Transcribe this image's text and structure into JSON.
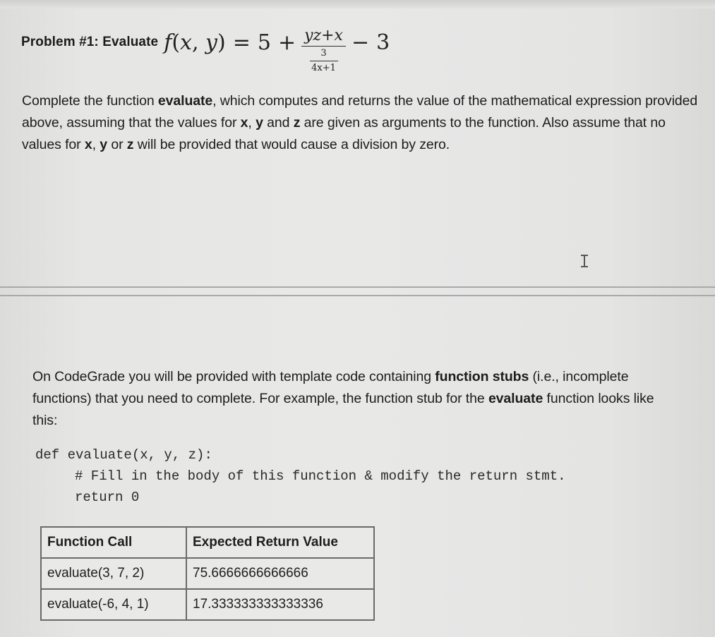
{
  "problem": {
    "heading_label": "Problem #1: Evaluate",
    "formula": {
      "lhs_func": "f",
      "lhs_args_open": "(",
      "lhs_x": "x",
      "lhs_sep": ", ",
      "lhs_y": "y",
      "lhs_args_close": ")",
      "equals": "=",
      "constant": "5",
      "plus": "+",
      "numerator": "yz+x",
      "inner_numerator": "3",
      "inner_denominator": "4x+1",
      "minus": "−",
      "subtrahend": "3"
    }
  },
  "intro": {
    "t1": "Complete the function ",
    "b1": "evaluate",
    "t2": ", which computes and returns the value of the mathematical expression provided above, assuming that the values for ",
    "b2": "x",
    "t3": ", ",
    "b3": "y",
    "t4": " and ",
    "b4": "z",
    "t5": " are given as arguments to the function. Also assume that no values for ",
    "b5": "x",
    "t6": ", ",
    "b6": "y",
    "t7": " or ",
    "b7": "z",
    "t8": " will be provided that would cause a division by zero."
  },
  "stub_intro": {
    "t1": "On CodeGrade you will be provided with template code containing ",
    "b1": "function stubs",
    "t2": " (i.e., incomplete functions) that you need to complete. For example, the function stub for the ",
    "b2": "evaluate",
    "t3": " function looks like this:"
  },
  "code": {
    "lines": [
      "def evaluate(x, y, z):",
      "# Fill in the body of this function & modify the return stmt.",
      "return 0"
    ]
  },
  "table": {
    "headers": [
      "Function Call",
      "Expected Return Value"
    ],
    "rows": [
      [
        "evaluate(3, 7, 2)",
        "75.6666666666666"
      ],
      [
        "evaluate(-6, 4, 1)",
        "17.333333333333336"
      ]
    ]
  },
  "colors": {
    "background": "#e6e6e4",
    "text": "#1c1c1c",
    "table_border": "#6a6a6a",
    "page_break_line": "#a9a9a9"
  }
}
